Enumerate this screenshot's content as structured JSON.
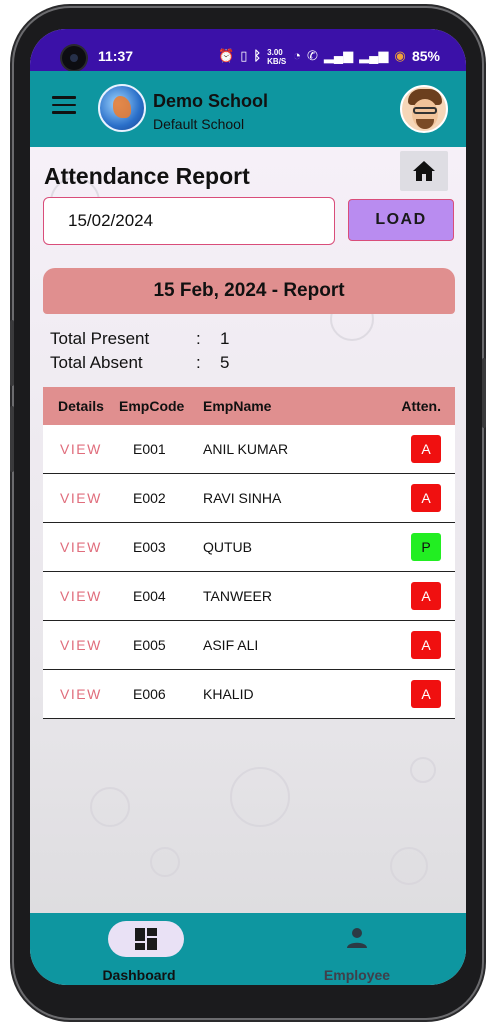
{
  "status_bar": {
    "time": "11:37",
    "data_rate": "3.00 KB/S",
    "battery": "85%"
  },
  "app_bar": {
    "school_name": "Demo School",
    "school_sub": "Default School"
  },
  "page": {
    "title": "Attendance Report",
    "date_value": "15/02/2024",
    "load_label": "LOAD",
    "report_title": "15 Feb, 2024 - Report"
  },
  "summary": [
    {
      "label": "Total Present",
      "sep": ":",
      "value": "1"
    },
    {
      "label": "Total Absent",
      "sep": ":",
      "value": "5"
    }
  ],
  "table": {
    "headers": [
      "Details",
      "EmpCode",
      "EmpName",
      "Atten."
    ],
    "rows": [
      {
        "details": "VIEW",
        "code": "E001",
        "name": "ANIL KUMAR",
        "att": "A"
      },
      {
        "details": "VIEW",
        "code": "E002",
        "name": "RAVI SINHA",
        "att": "A"
      },
      {
        "details": "VIEW",
        "code": "E003",
        "name": "QUTUB",
        "att": "P"
      },
      {
        "details": "VIEW",
        "code": "E004",
        "name": "TANWEER",
        "att": "A"
      },
      {
        "details": "VIEW",
        "code": "E005",
        "name": "ASIF ALI",
        "att": "A"
      },
      {
        "details": "VIEW",
        "code": "E006",
        "name": "KHALID",
        "att": "A"
      }
    ]
  },
  "colors": {
    "appbar": "#0e96a0",
    "status_bar": "#3b11a8",
    "banner": "#e08f8f",
    "absent": "#f01010",
    "present": "#22ee22",
    "load_button": "#b98cf0"
  },
  "bottom_nav": [
    {
      "label": "Dashboard",
      "icon": "dashboard-icon",
      "active": true
    },
    {
      "label": "Employee",
      "icon": "person-icon",
      "active": false
    }
  ]
}
